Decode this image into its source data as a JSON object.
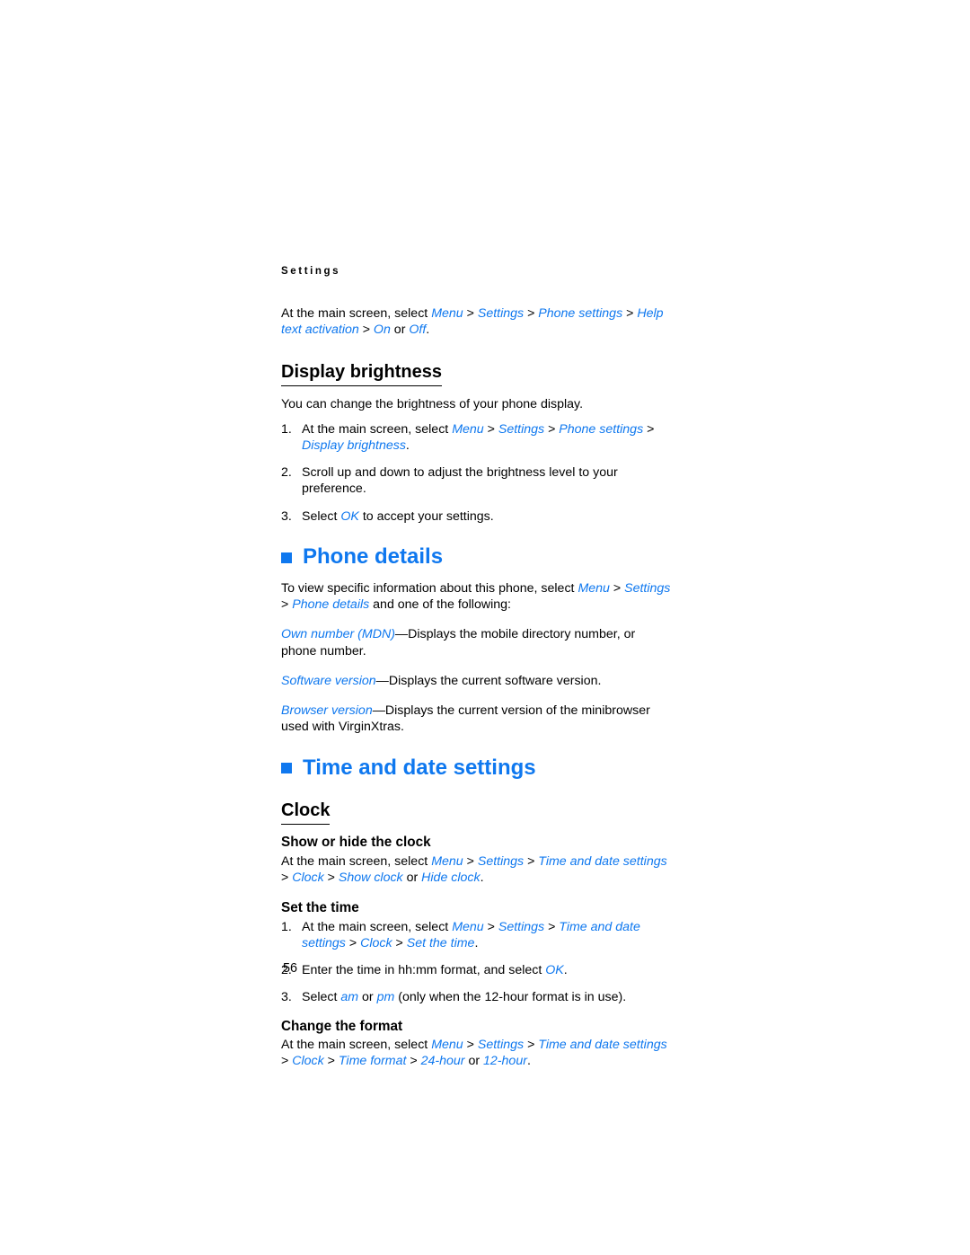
{
  "document": {
    "running_header": "Settings",
    "page_number": "56",
    "accent_color": "#0f78ef",
    "text_color": "#000000",
    "background_color": "#ffffff"
  },
  "intro": {
    "lead": "At the main screen, select ",
    "path": [
      "Menu",
      "Settings",
      "Phone settings",
      "Help text activation",
      "On"
    ],
    "tail_or": " or ",
    "tail_option": "Off",
    "end": "."
  },
  "display_brightness": {
    "heading": "Display brightness",
    "description": "You can change the brightness of your phone display.",
    "steps": [
      {
        "number": "1.",
        "lead": "At the main screen, select ",
        "path": [
          "Menu",
          "Settings",
          "Phone settings",
          "Display brightness"
        ],
        "end": "."
      },
      {
        "number": "2.",
        "text": "Scroll up and down to adjust the brightness level to your preference."
      },
      {
        "number": "3.",
        "lead": "Select ",
        "term": "OK",
        "tail": " to accept your settings."
      }
    ]
  },
  "phone_details": {
    "heading": "Phone details",
    "bullet_icon": "square-bullet",
    "intro_lead": "To view specific information about this phone, select ",
    "intro_path": [
      "Menu",
      "Settings",
      "Phone details"
    ],
    "intro_tail": " and one of the following:",
    "definitions": [
      {
        "term": "Own number (MDN)",
        "dash": "—",
        "description": "Displays the mobile directory number, or phone number."
      },
      {
        "term": "Software version",
        "dash": "—",
        "description": "Displays the current software version."
      },
      {
        "term": "Browser version",
        "dash": "—",
        "description": "Displays the current version of the minibrowser used with VirginXtras."
      }
    ]
  },
  "time_and_date": {
    "heading": "Time and date settings",
    "bullet_icon": "square-bullet",
    "clock_heading": "Clock",
    "show_hide": {
      "heading": "Show or hide the clock",
      "lead": "At the main screen, select ",
      "path": [
        "Menu",
        "Settings",
        "Time and date settings",
        "Clock",
        "Show clock"
      ],
      "tail_or": " or ",
      "tail_option": "Hide clock",
      "end": "."
    },
    "set_time": {
      "heading": "Set the time",
      "steps": [
        {
          "number": "1.",
          "lead": "At the main screen, select ",
          "path": [
            "Menu",
            "Settings",
            "Time and date settings",
            "Clock",
            "Set the time"
          ],
          "end": "."
        },
        {
          "number": "2.",
          "lead": "Enter the time in hh:mm format, and select ",
          "term": "OK",
          "tail": "."
        },
        {
          "number": "3.",
          "lead": "Select ",
          "term_a": "am",
          "mid": " or ",
          "term_b": "pm",
          "tail": " (only when the 12-hour format is in use)."
        }
      ]
    },
    "change_format": {
      "heading": "Change the format",
      "lead": "At the main screen, select ",
      "path": [
        "Menu",
        "Settings",
        "Time and date settings",
        "Clock",
        "Time format",
        "24-hour"
      ],
      "tail_or": " or ",
      "tail_option": "12-hour",
      "end": "."
    }
  }
}
